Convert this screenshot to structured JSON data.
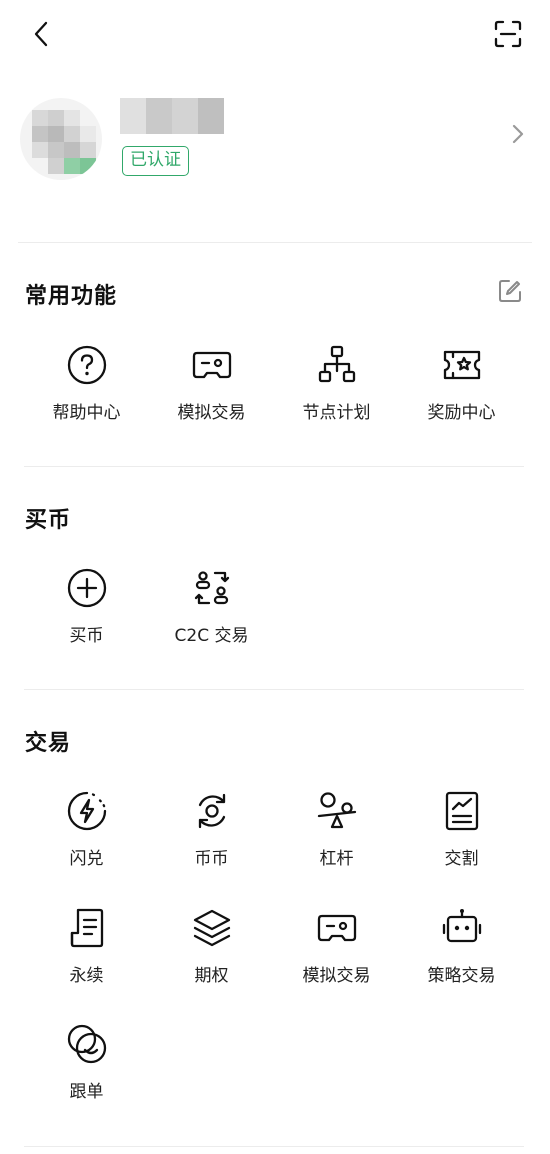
{
  "profile": {
    "verified_badge": "已认证"
  },
  "sections": {
    "common": {
      "title": "常用功能",
      "items": [
        "帮助中心",
        "模拟交易",
        "节点计划",
        "奖励中心"
      ]
    },
    "buy": {
      "title": "买币",
      "items": [
        "买币",
        "C2C 交易"
      ]
    },
    "trade": {
      "title": "交易",
      "items": [
        "闪兑",
        "币币",
        "杠杆",
        "交割",
        "永续",
        "期权",
        "模拟交易",
        "策略交易",
        "跟单"
      ]
    }
  },
  "icons": {
    "back": "back-arrow-icon",
    "scan": "scan-icon",
    "chevron": "chevron-right-icon",
    "edit": "edit-icon"
  },
  "colors": {
    "accent_green": "#31a86a",
    "text": "#1a1a1a",
    "divider": "#ececec"
  }
}
